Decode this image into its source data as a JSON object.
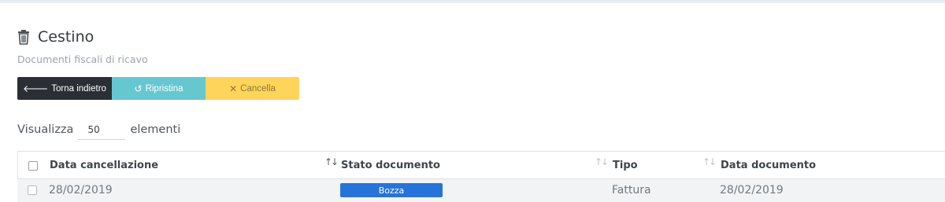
{
  "header": {
    "title": "Cestino",
    "subtitle": "Documenti fiscali di ricavo",
    "title_icon": "trash-icon"
  },
  "actions": {
    "back_label": "Torna indietro",
    "back_icon": "arrow-left-icon",
    "restore_label": "Ripristina",
    "restore_icon": "undo-icon",
    "delete_label": "Cancella",
    "delete_icon": "close-icon"
  },
  "page_size": {
    "prefix": "Visualizza",
    "value": "50",
    "suffix": "elementi"
  },
  "table": {
    "columns": [
      {
        "label": "Data cancellazione"
      },
      {
        "label": "Stato documento"
      },
      {
        "label": "Tipo"
      },
      {
        "label": "Data documento"
      }
    ],
    "rows": [
      {
        "data_cancellazione": "28/02/2019",
        "stato": "Bozza",
        "tipo": "Fattura",
        "data_documento": "28/02/2019"
      }
    ]
  },
  "colors": {
    "back_button": "#2b2f35",
    "restore_button": "#66c7d1",
    "delete_button": "#ffd45a",
    "status_badge": "#2673d9"
  }
}
